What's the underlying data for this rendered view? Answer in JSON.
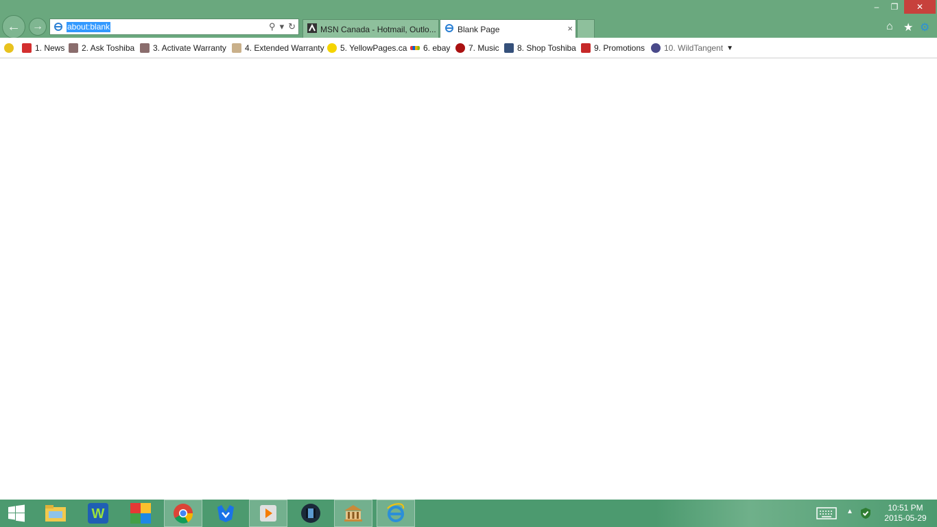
{
  "browser": {
    "address": {
      "url": "about:blank"
    },
    "tabs": [
      {
        "label": "MSN Canada - Hotmail, Outlo..."
      },
      {
        "label": "Blank Page",
        "close": "×"
      }
    ],
    "window_controls": {
      "minimize": "–",
      "maximize": "❐",
      "close": "✕"
    }
  },
  "favorites": [
    {
      "label": "1. News"
    },
    {
      "label": "2. Ask Toshiba"
    },
    {
      "label": "3. Activate Warranty"
    },
    {
      "label": "4. Extended Warranty"
    },
    {
      "label": "5. YellowPages.ca"
    },
    {
      "label": "6. ebay"
    },
    {
      "label": "7. Music"
    },
    {
      "label": "8. Shop Toshiba"
    },
    {
      "label": "9. Promotions"
    },
    {
      "label": "10. WildTangent"
    }
  ],
  "taskbar": {
    "time": "10:51 PM",
    "date": "2015-05-29"
  },
  "colors": {
    "chrome": "#6aa87e",
    "taskbar": "#4c9a6f",
    "close_red": "#c7413c",
    "selection": "#3399ff"
  }
}
